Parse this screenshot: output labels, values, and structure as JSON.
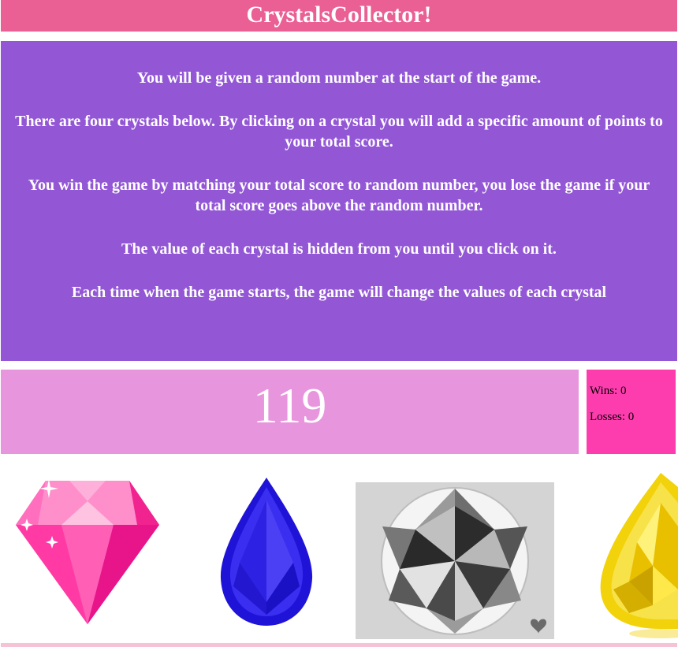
{
  "header": {
    "title": "CrystalsCollector!"
  },
  "instructions": [
    "You will be given a random number at the start of the game.",
    "There are four crystals below. By clicking on a crystal you will add a specific amount of points to your total score.",
    "You win the game by matching your total score to random number, you lose the game if your total score goes above the random number.",
    "The value of each crystal is hidden from you until you click on it.",
    "Each time when the game starts, the game will change the values of each crystal"
  ],
  "target": {
    "number": "119"
  },
  "score": {
    "wins": "Wins: 0",
    "losses": "Losses: 0"
  },
  "crystals": [
    {
      "name": "pink-crystal",
      "color": "#ff3aa5"
    },
    {
      "name": "blue-crystal",
      "color": "#2a1ee8"
    },
    {
      "name": "white-diamond",
      "color": "#d8d8d8"
    },
    {
      "name": "yellow-crystal",
      "color": "#f5d80a"
    }
  ],
  "colors": {
    "header": "#ea5f94",
    "instructions": "#9357d6",
    "target": "#e796dd",
    "score": "#fd3dae"
  }
}
